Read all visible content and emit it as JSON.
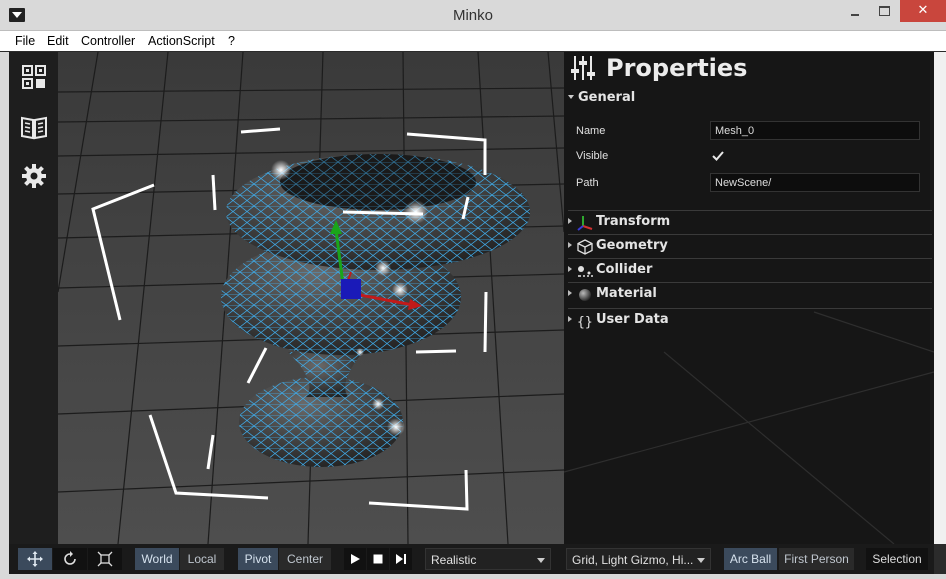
{
  "window": {
    "title": "Minko",
    "close_glyph": "✕"
  },
  "menu": [
    "File",
    "Edit",
    "Controller",
    "ActionScript",
    "?"
  ],
  "left_toolbar": [
    "scene-graph-icon",
    "library-book-icon",
    "settings-gear-icon"
  ],
  "properties": {
    "title": "Properties",
    "general": {
      "label": "General",
      "name_label": "Name",
      "name_value": "Mesh_0",
      "visible_label": "Visible",
      "visible_checked": true,
      "path_label": "Path",
      "path_value": "NewScene/"
    },
    "sections": [
      {
        "label": "Transform",
        "icon": "transform-axes-icon"
      },
      {
        "label": "Geometry",
        "icon": "geometry-cube-icon"
      },
      {
        "label": "Collider",
        "icon": "collider-icon"
      },
      {
        "label": "Material",
        "icon": "material-sphere-icon"
      },
      {
        "label": "User Data",
        "icon": "user-data-braces-icon"
      }
    ]
  },
  "bottom_bar": {
    "tools": [
      "move-tool-icon",
      "rotate-tool-icon",
      "scale-tool-icon"
    ],
    "space": {
      "world": "World",
      "local": "Local",
      "active": "World"
    },
    "pivot": {
      "pivot": "Pivot",
      "center": "Center",
      "active": "Pivot"
    },
    "playback": [
      "play-icon",
      "stop-icon",
      "step-icon"
    ],
    "render_mode": "Realistic",
    "overlays": "Grid, Light Gizmo, Hi...",
    "camera": {
      "arcball": "Arc Ball",
      "first_person": "First Person",
      "active": "Arc Ball"
    },
    "selection": "Selection"
  },
  "colors": {
    "wireframe": "#3fa9e6",
    "selection_box": "#ffffff",
    "close_button": "#c9463d",
    "active_toggle": "#3b4a5c"
  }
}
